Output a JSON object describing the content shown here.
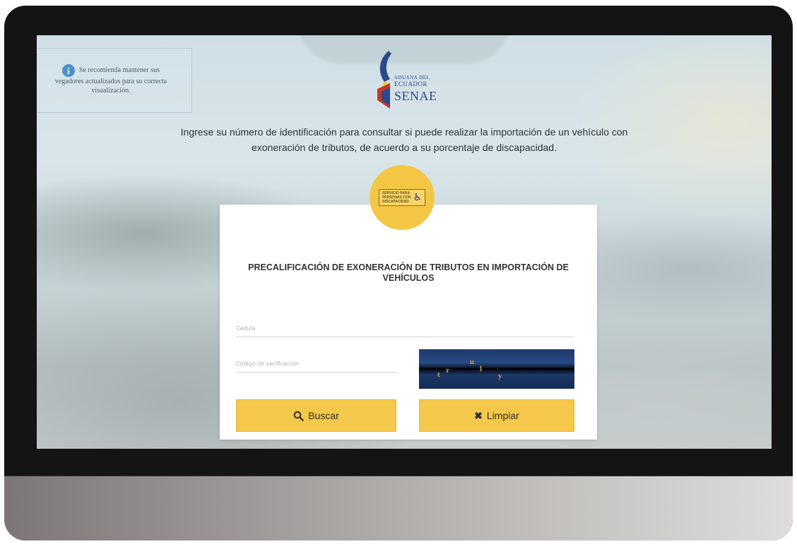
{
  "notice": {
    "icon": "info-icon",
    "line1": "Se recomienda mantener sus",
    "line2": "vegadores actualizados para su correcta",
    "line3": "visualización."
  },
  "logo": {
    "small": "ADUANA DEL",
    "middle": "ECUADOR",
    "big": "SENAE",
    "colors": {
      "blue": "#2a4a8a",
      "yellow": "#f3c643",
      "red": "#c0392b"
    }
  },
  "intro": {
    "line1": "Ingrese su número de identificación para consultar si puede realizar la importación de un vehículo con",
    "line2": "exoneración de tributos, de acuerdo a su porcentaje de discapacidad."
  },
  "badge": {
    "line1": "SERVICIO PARA",
    "line2": "PERSONAS CON",
    "line3": "DISCAPACIDAD",
    "icon": "wheelchair-icon",
    "color": "#f3c643"
  },
  "form": {
    "title": "PRECALIFICACIÓN DE EXONERACIÓN DE TRIBUTOS EN IMPORTACIÓN DE VEHÍCULOS",
    "cedula_placeholder": "Cédula",
    "codigo_placeholder": "Código de verificación",
    "captcha_chars": [
      "t",
      "r",
      "u",
      "l",
      "y"
    ],
    "buscar_label": "Buscar",
    "limpiar_label": "Limpiar",
    "buscar_icon": "search-icon",
    "limpiar_icon": "close-icon",
    "button_color": "#f4c84a"
  }
}
